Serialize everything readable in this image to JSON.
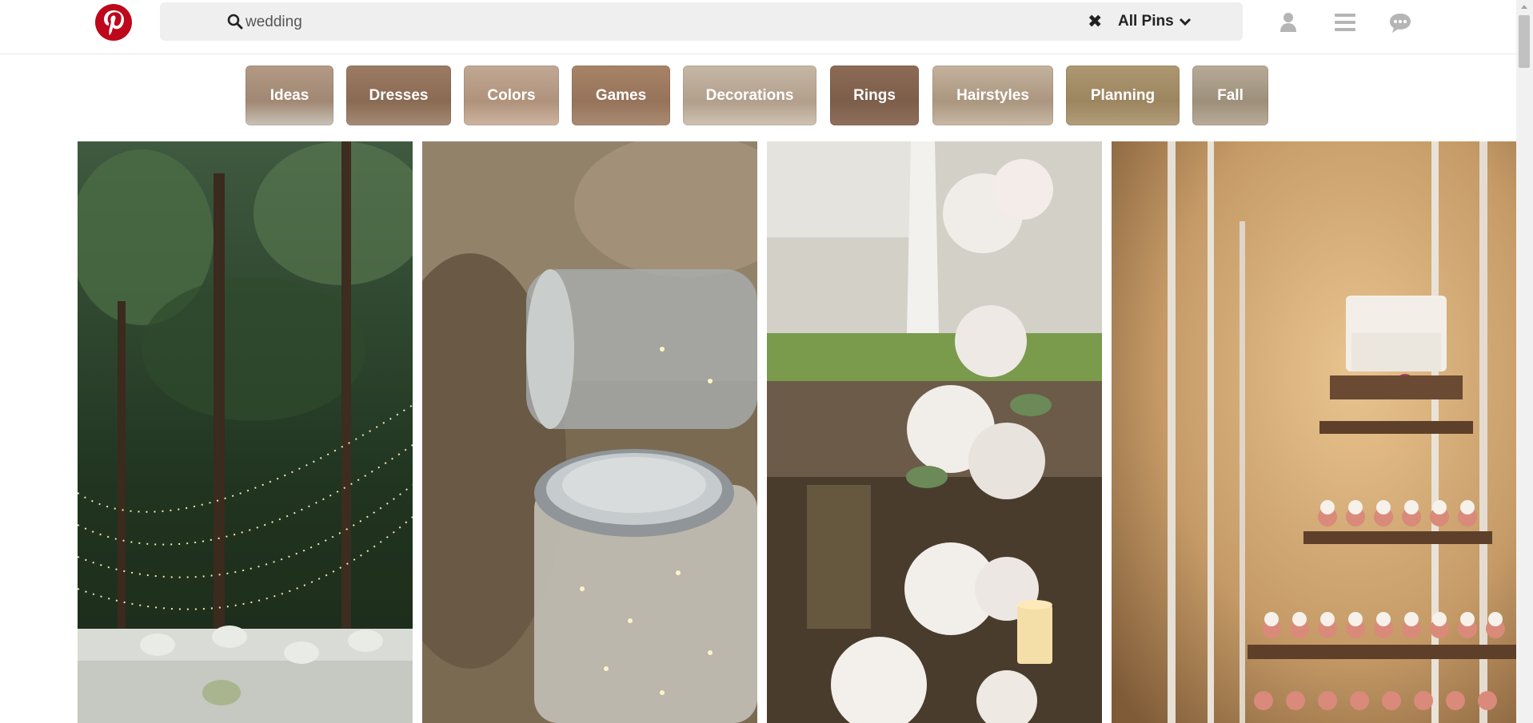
{
  "header": {
    "logo_icon": "pinterest-logo-icon",
    "search": {
      "value": "wedding",
      "placeholder": "Search"
    },
    "clear_icon": "✖",
    "scope_label": "All Pins",
    "icons": [
      "user-icon",
      "menu-icon",
      "chat-icon"
    ]
  },
  "categories": [
    {
      "label": "Ideas"
    },
    {
      "label": "Dresses"
    },
    {
      "label": "Colors"
    },
    {
      "label": "Games"
    },
    {
      "label": "Decorations"
    },
    {
      "label": "Rings"
    },
    {
      "label": "Hairstyles"
    },
    {
      "label": "Planning"
    },
    {
      "label": "Fall"
    }
  ],
  "pins": [
    {
      "subject": "forest-wedding-string-lights"
    },
    {
      "subject": "mason-jar-fairy-lights"
    },
    {
      "subject": "white-hydrangea-centerpieces"
    },
    {
      "subject": "cake-and-cupcake-tower"
    }
  ],
  "colors": {
    "brand": "#bd081c",
    "search_bg": "#efefef",
    "icon_gray": "#b5b5b5"
  }
}
